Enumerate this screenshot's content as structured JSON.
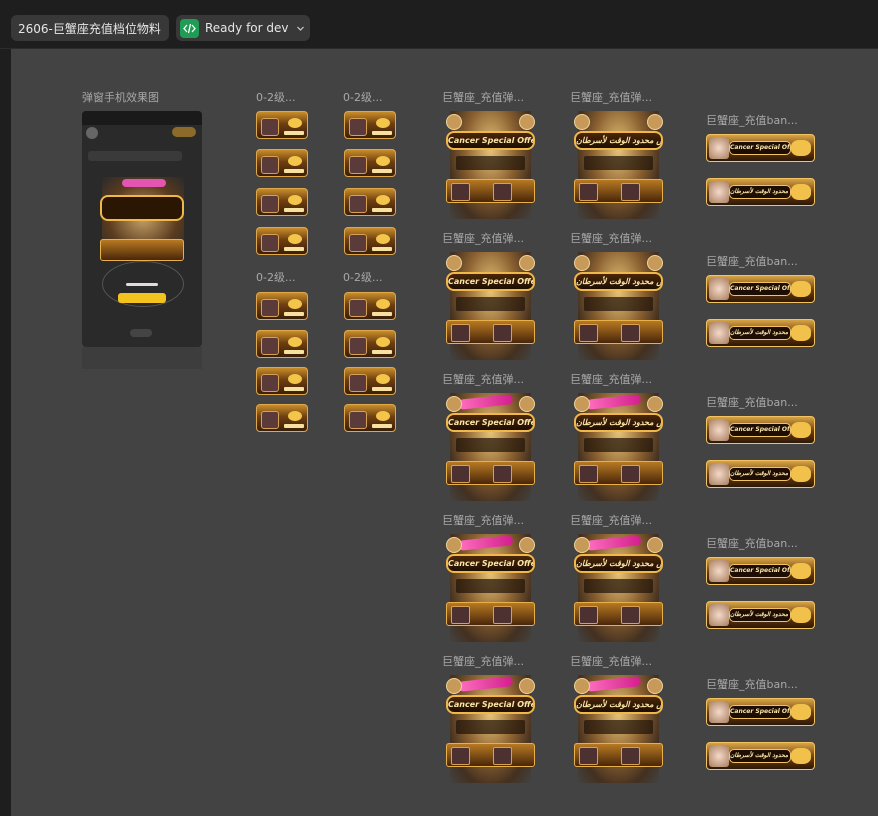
{
  "topbar": {
    "file_name": "2606-巨蟹座充值档位物料",
    "status_label": "Ready for dev"
  },
  "canvas": {
    "phone_frame": {
      "label": "弹窗手机效果图"
    },
    "small_groups": [
      {
        "label": "0-2级..."
      },
      {
        "label": "0-2级..."
      },
      {
        "label": "0-2级..."
      },
      {
        "label": "0-2级..."
      }
    ],
    "popup_label": "巨蟹座_充值弹...",
    "banner_label": "巨蟹座_充值ban...",
    "popup_banner_text": "Cancer Special Offer",
    "popup_banner_text_ar": "عرض محدود الوقت لأسرطان",
    "banner_text": "Cancer Special Offer",
    "banner_text_ar": "عرض محدود الوقت لأسرطان"
  },
  "colors": {
    "app_bg": "#1e1e1e",
    "canvas_bg": "#434343",
    "status_green": "#1f9d55",
    "gold": "#f0b84a"
  },
  "icons": {
    "status": "code-icon",
    "dropdown": "chevron-down-icon"
  }
}
